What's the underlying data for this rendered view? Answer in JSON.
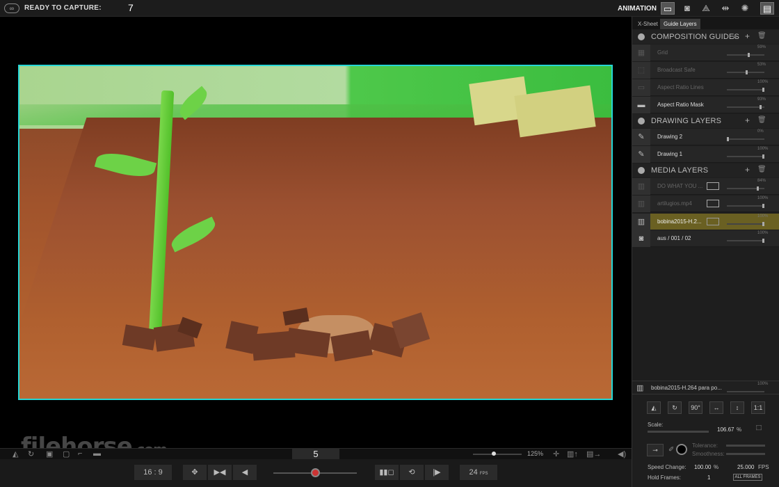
{
  "topbar": {
    "ready_label": "READY TO CAPTURE:",
    "capture_count": "7",
    "mode_label": "ANIMATION"
  },
  "viewer": {
    "frame_number": "5",
    "zoom": "125%"
  },
  "bottombar": {
    "aspect": "16 : 9",
    "fps_value": "24",
    "fps_unit": "FPS"
  },
  "watermark": {
    "brand": "filehorse",
    "suffix": ".com"
  },
  "panel": {
    "tabs": [
      "X-Sheet",
      "Guide Layers"
    ],
    "composition": {
      "title": "COMPOSITION GUIDES",
      "items": [
        {
          "label": "Grid",
          "pct": "59%",
          "level": 0.59
        },
        {
          "label": "Broadcast Safe",
          "pct": "53%",
          "level": 0.53
        },
        {
          "label": "Aspect Ratio Lines",
          "pct": "100%",
          "level": 1.0
        },
        {
          "label": "Aspect Ratio Mask",
          "pct": "93%",
          "level": 0.93
        }
      ]
    },
    "drawing": {
      "title": "DRAWING LAYERS",
      "items": [
        {
          "label": "Drawing 2",
          "pct": "0%",
          "level": 0.0
        },
        {
          "label": "Drawing 1",
          "pct": "100%",
          "level": 1.0
        }
      ]
    },
    "media": {
      "title": "MEDIA LAYERS",
      "items": [
        {
          "label": "DO WHAT YOU ...",
          "pct": "84%",
          "level": 0.84
        },
        {
          "label": "artilugios.mp4",
          "pct": "100%",
          "level": 1.0
        },
        {
          "label": "bobina2015-H.2...",
          "pct": "100%",
          "level": 1.0
        },
        {
          "label": "aus / 001 / 02",
          "pct": "100%",
          "level": 1.0
        }
      ]
    },
    "selected_layer": {
      "label": "bobina2015-H.264 para po...",
      "pct": "100%"
    },
    "tools": [
      "90°",
      "1:1"
    ],
    "scale_label": "Scale:",
    "scale_value": "106.67",
    "scale_unit": "%",
    "tolerance_label": "Tolerance:",
    "smoothness_label": "Smoothness:",
    "speed_label": "Speed Change:",
    "speed_value": "100.00",
    "speed_unit": "%",
    "fps_value": "25.000",
    "fps_unit": "FPS",
    "hold_label": "Hold Frames:",
    "hold_value": "1",
    "all_frames": "ALL FRAMES"
  }
}
